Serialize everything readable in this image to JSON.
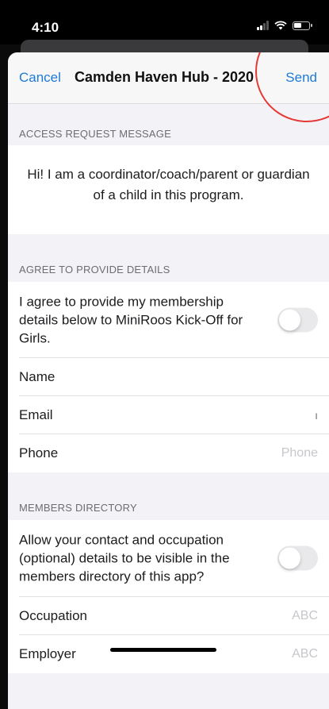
{
  "status_bar": {
    "time": "4:10"
  },
  "nav": {
    "cancel_label": "Cancel",
    "title": "Camden Haven Hub - 2020",
    "send_label": "Send",
    "accent_color": "#1e7ad6"
  },
  "access_request": {
    "header": "ACCESS REQUEST MESSAGE",
    "message": "Hi! I am a coordinator/coach/parent or guardian of a child in this program."
  },
  "agree_section": {
    "header": "AGREE TO PROVIDE DETAILS",
    "agree_text": "I agree to provide my membership details below to MiniRoos Kick-Off for Girls.",
    "agree_toggle_on": false,
    "name_label": "Name",
    "name_value": "",
    "email_label": "Email",
    "email_value": "",
    "phone_label": "Phone",
    "phone_placeholder": "Phone"
  },
  "directory_section": {
    "header": "MEMBERS DIRECTORY",
    "allow_text": "Allow your contact and occupation (optional) details to be visible in the members directory of this app?",
    "allow_toggle_on": false,
    "occupation_label": "Occupation",
    "occupation_placeholder": "ABC",
    "employer_label": "Employer",
    "employer_placeholder": "ABC"
  },
  "icons": [
    "signal-icon",
    "wifi-icon",
    "battery-icon"
  ],
  "annotation_color": "#e53935"
}
